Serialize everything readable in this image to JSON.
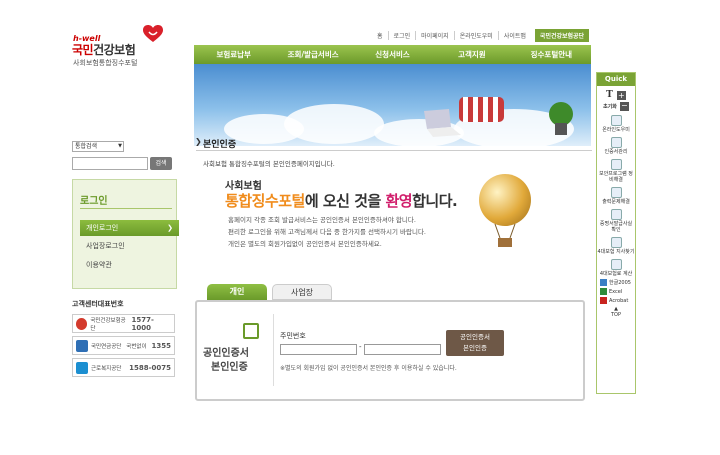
{
  "logo": {
    "hwell": "h-well",
    "name_a": "국민",
    "name_b": "건강보험",
    "subtitle": "사회보험통합징수포털"
  },
  "util_nav": [
    "홈",
    "로그인",
    "마이페이지",
    "온라인도우미",
    "사이트맵"
  ],
  "site_select": "국민건강보험공단",
  "gnb": [
    "보험료납부",
    "조회/발급서비스",
    "신청서비스",
    "고객지원",
    "징수포털안내"
  ],
  "search": {
    "select": "통합검색",
    "button": "검색"
  },
  "login": {
    "title": "로그인",
    "items": [
      "개인로그인",
      "사업장로그인",
      "이용약관"
    ]
  },
  "call_center": {
    "title": "고객센터대표번호",
    "rows": [
      {
        "name": "국민건강보험공단",
        "number": "1577-1000",
        "color": "#d33a2c"
      },
      {
        "name": "국민연금공단",
        "number": "1355",
        "prefix": "국번없이",
        "color": "#2f6fb5"
      },
      {
        "name": "근로복지공단",
        "number": "1588-0075",
        "color": "#1c8fd1"
      }
    ]
  },
  "page": {
    "title": "본인인증",
    "desc": "사회보험 통합징수포털의 본인인증페이지입니다.",
    "welcome_line1": "사회보험",
    "welcome_a": "통합징수포털",
    "welcome_b": "에 오신 것을 ",
    "welcome_c": "환영",
    "welcome_d": "합니다.",
    "info1": "홈페이지 각종 조회 발급서비스는 공인인증서 본인인증하셔야 합니다.",
    "info2": "편리한 로그인을 위해 고객님께서 다음 중 한가지를 선택하시기 바랍니다.",
    "info3": "개인은 별도의 회원가입없이 공인인증서 본인인증하세요."
  },
  "tabs": [
    "개인",
    "사업장"
  ],
  "cert_panel": {
    "title1": "공인인증서",
    "title2": "본인인증",
    "jumin_label": "주민번호",
    "dash": "-",
    "button_l1": "공인인증서",
    "button_l2": "본인인증",
    "note": "※별도의 회원가입 없이 공인인증서 본인인증 후 이용하실 수 있습니다."
  },
  "quick": {
    "title": "Quick",
    "font_label": "T",
    "reset": "초기화",
    "items": [
      "온라인도우미",
      "인증서관리",
      "보안프로그램 정비해결",
      "출력문제해결",
      "증명서발급사실 확인",
      "4대보험 지사찾기",
      "4대보험료 계산",
      "한글2005",
      "Excel",
      "Acrobat",
      "TOP"
    ]
  }
}
